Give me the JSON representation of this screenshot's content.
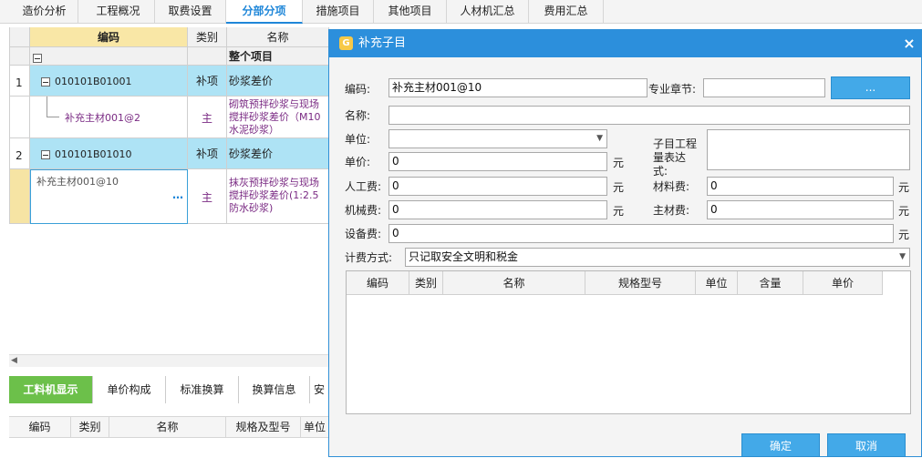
{
  "top_tabs": [
    "造价分析",
    "工程概况",
    "取费设置",
    "分部分项",
    "措施项目",
    "其他项目",
    "人材机汇总",
    "费用汇总"
  ],
  "grid": {
    "headers": {
      "code": "编码",
      "type": "类别",
      "name": "名称"
    },
    "whole_project": "整个项目",
    "rows": [
      {
        "num": "1",
        "code": "010101B01001",
        "type": "补项",
        "name": "砂浆差价"
      },
      {
        "code": "补充主材001@2",
        "type": "主",
        "name": "砌筑预拌砂浆与现场搅拌砂浆差价（M10水泥砂浆）"
      },
      {
        "num": "2",
        "code": "010101B01010",
        "type": "补项",
        "name": "砂浆差价"
      },
      {
        "code": "补充主材001@10",
        "ellipsis": "…",
        "type": "主",
        "name": "抹灰预拌砂浆与现场搅拌砂浆差价(1:2.5防水砂浆)"
      }
    ]
  },
  "bottom_tabs": [
    "工料机显示",
    "单价构成",
    "标准换算",
    "换算信息",
    "安"
  ],
  "sub_headers": [
    "编码",
    "类别",
    "名称",
    "规格及型号",
    "单位"
  ],
  "dialog": {
    "title": "补充子目",
    "close": "×",
    "code_label": "编码:",
    "code_value": "补充主材001@10",
    "chapter_label": "专业章节:",
    "chapter_value": "",
    "chapter_button": "...",
    "name_label": "名称:",
    "name_value": "",
    "unit_label": "单位:",
    "unit_value": "",
    "expr_label": "子目工程量表达式:",
    "expr_value": "",
    "price_label": "单价:",
    "price_value": "0",
    "labor_label": "人工费:",
    "labor_value": "0",
    "material_label": "材料费:",
    "material_value": "0",
    "machine_label": "机械费:",
    "machine_value": "0",
    "main_material_label": "主材费:",
    "main_material_value": "0",
    "equipment_label": "设备费:",
    "equipment_value": "0",
    "yuan": "元",
    "fee_mode_label": "计费方式:",
    "fee_mode_value": "只记取安全文明和税金",
    "table_headers": [
      "编码",
      "类别",
      "名称",
      "规格型号",
      "单位",
      "含量",
      "单价"
    ],
    "ok": "确定",
    "cancel": "取消"
  }
}
